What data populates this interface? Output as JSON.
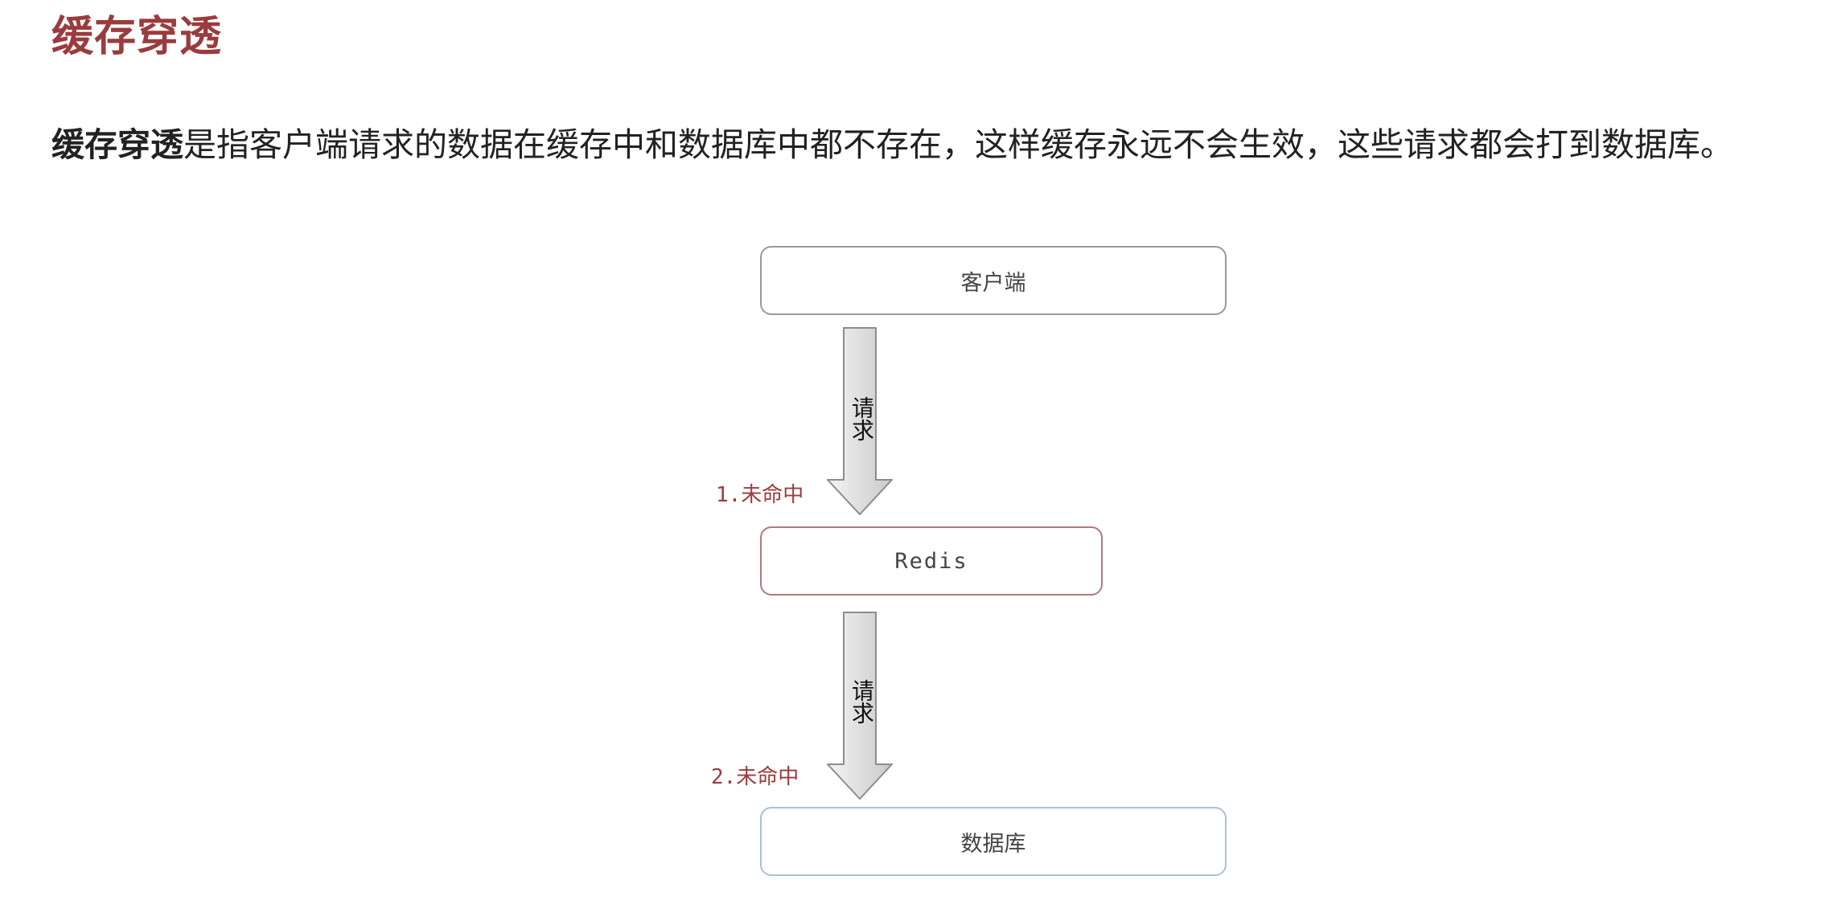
{
  "heading": "缓存穿透",
  "paragraph": {
    "term": "缓存穿透",
    "text": "是指客户端请求的数据在缓存中和数据库中都不存在，这样缓存永远不会生效，这些请求都会打到数据库。"
  },
  "diagram": {
    "nodes": {
      "client": "客户端",
      "redis": "Redis",
      "database": "数据库"
    },
    "arrows": [
      {
        "label": "请求",
        "miss_label": "1.未命中"
      },
      {
        "label": "请求",
        "miss_label": "2.未命中"
      }
    ],
    "colors": {
      "heading": "#9b3b3e",
      "miss_label": "#9b3b3e",
      "client_border": "#9a9a9a",
      "redis_border": "#b07a7c",
      "database_border": "#a9c2d8",
      "arrow_fill_light": "#f4f4f4",
      "arrow_fill_dark": "#c9c9c9"
    }
  }
}
